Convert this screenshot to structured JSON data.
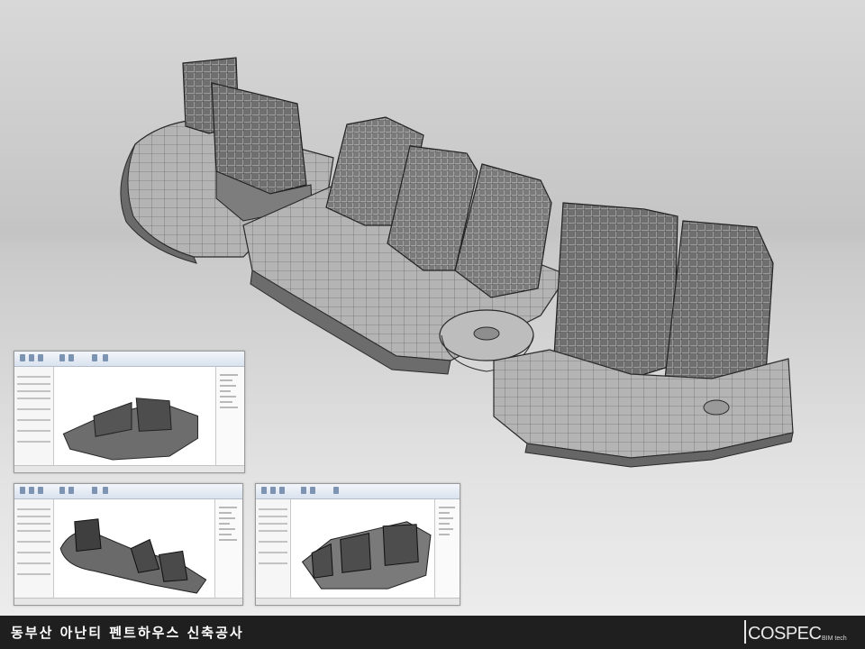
{
  "slide": {
    "title": "동부산 아난티 펜트하우스 신축공사",
    "logo_text": "COSPEC",
    "logo_sub": "BIM tech"
  },
  "hero_image": {
    "icon": "bim-building-model-image"
  },
  "thumbnails": [
    {
      "icon": "revit-screenshot-model-view-1"
    },
    {
      "icon": "revit-screenshot-model-view-2"
    },
    {
      "icon": "revit-screenshot-model-view-3"
    }
  ],
  "colors": {
    "footer_bg": "#1f1f1f",
    "footer_text": "#ffffff",
    "model_fill": "#8a8a8a",
    "model_line": "#2a2a2a"
  }
}
